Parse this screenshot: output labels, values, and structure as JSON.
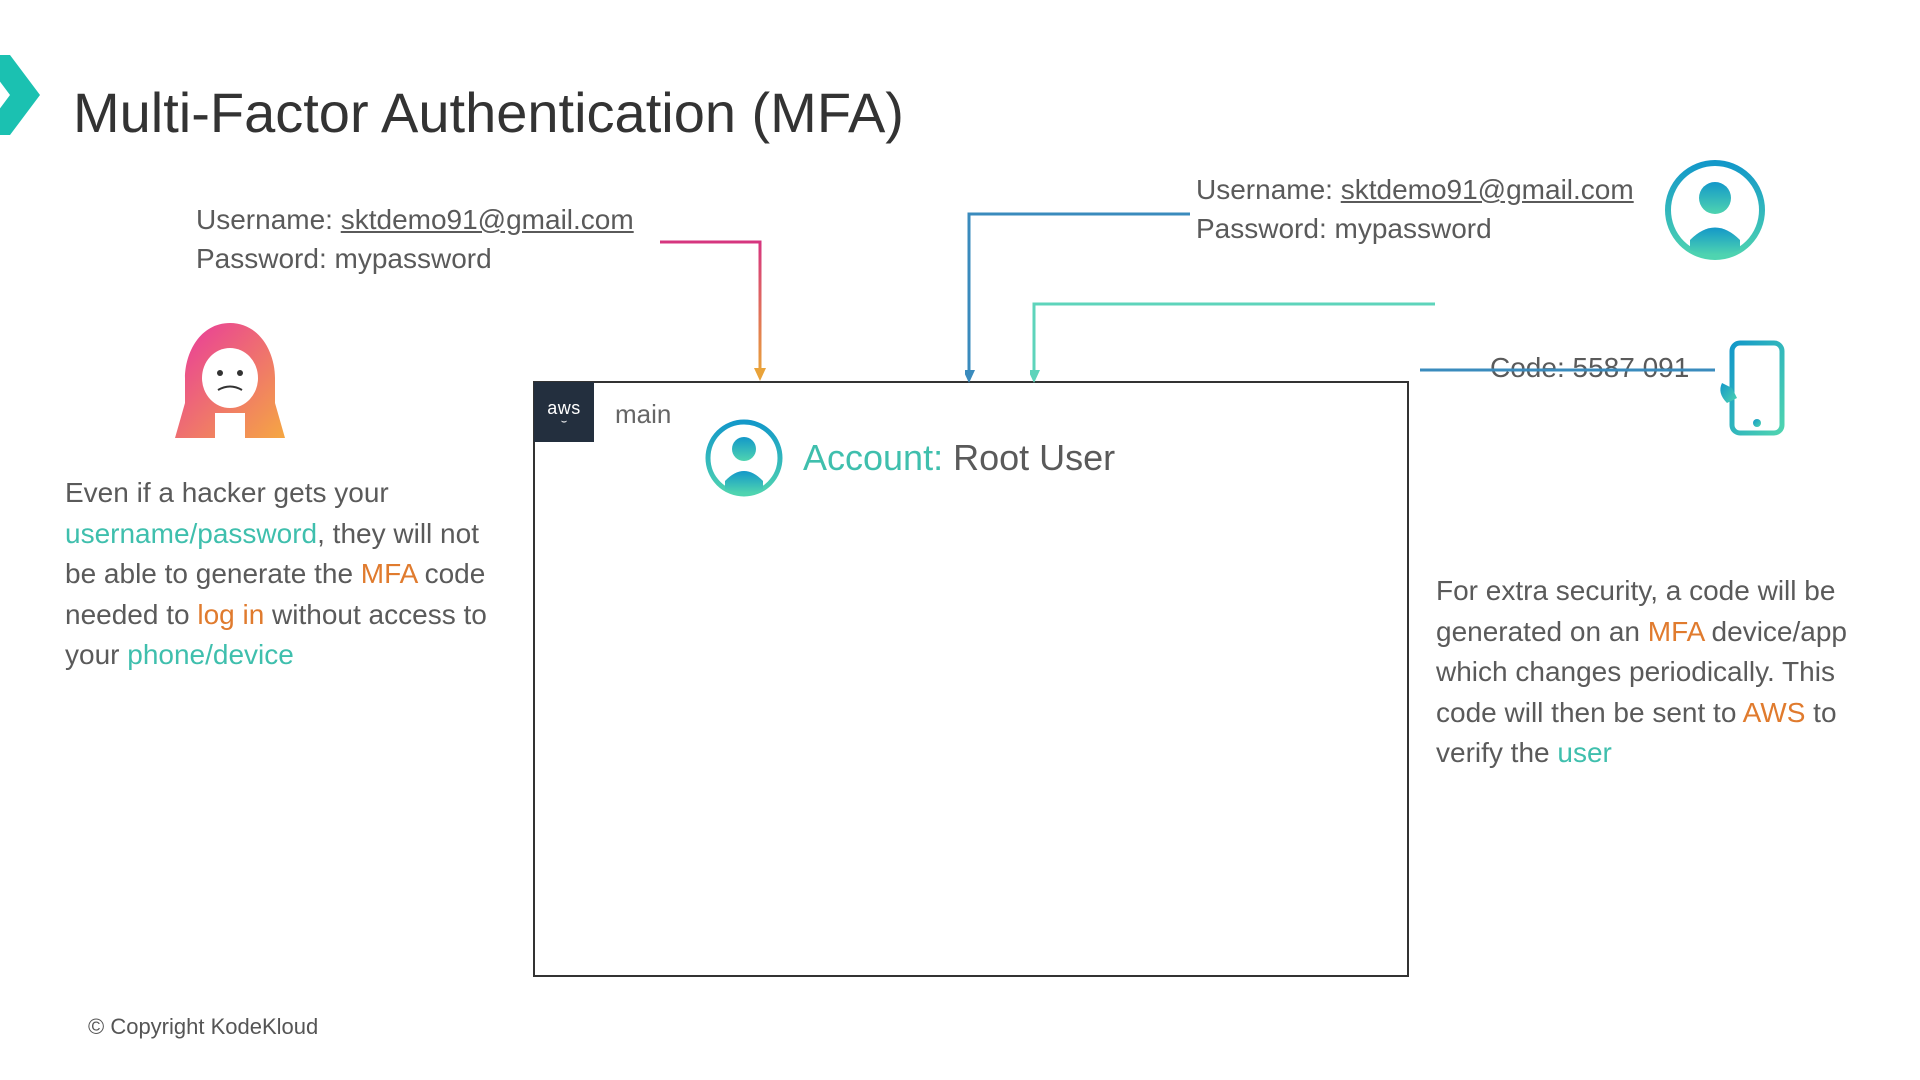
{
  "title": "Multi-Factor Authentication (MFA)",
  "hacker": {
    "username_label": "Username: ",
    "username_value": "sktdemo91@gmail.com",
    "password_label": "Password: ",
    "password_value": "mypassword"
  },
  "user": {
    "username_label": "Username: ",
    "username_value": "sktdemo91@gmail.com",
    "password_label": "Password: ",
    "password_value": "mypassword"
  },
  "mfa_code": {
    "label": "Code: ",
    "value": "5587 091"
  },
  "left_text": {
    "p1": "Even if a hacker gets your ",
    "hl1": "username/password",
    "p2": ", they will not be able to generate the ",
    "hl2": "MFA",
    "p3": " code needed to ",
    "hl3": "log in",
    "p4": " without access to your ",
    "hl4": "phone/device"
  },
  "right_text": {
    "p1": "For extra security, a code will be generated on an ",
    "hl1": "MFA",
    "p2": " device/app which changes periodically. This code will then be sent to ",
    "hl2": "AWS",
    "p3": " to verify the ",
    "hl3": "user"
  },
  "aws_panel": {
    "badge": "aws",
    "main_label": "main",
    "account_label": "Account:",
    "account_value": " Root User"
  },
  "copyright": "© Copyright KodeKloud"
}
